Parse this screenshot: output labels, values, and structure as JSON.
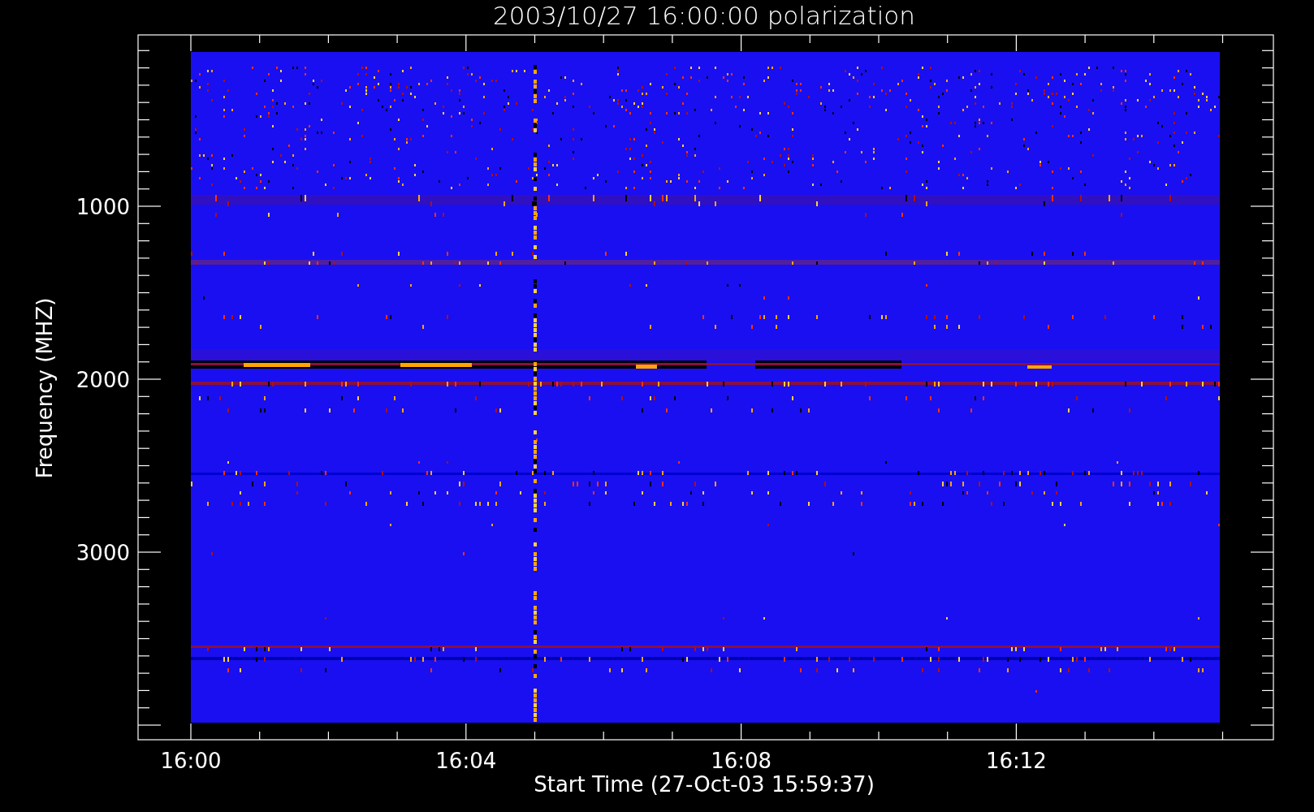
{
  "plot": {
    "title": "2003/10/27 16:00:00 polarization",
    "xlabel": "Start Time (27-Oct-03 15:59:37)",
    "ylabel": "Frequency (MHZ)",
    "x_tick_labels": [
      "16:00",
      "16:04",
      "16:08",
      "16:12"
    ],
    "y_tick_labels": [
      "1000",
      "2000",
      "3000"
    ]
  }
}
